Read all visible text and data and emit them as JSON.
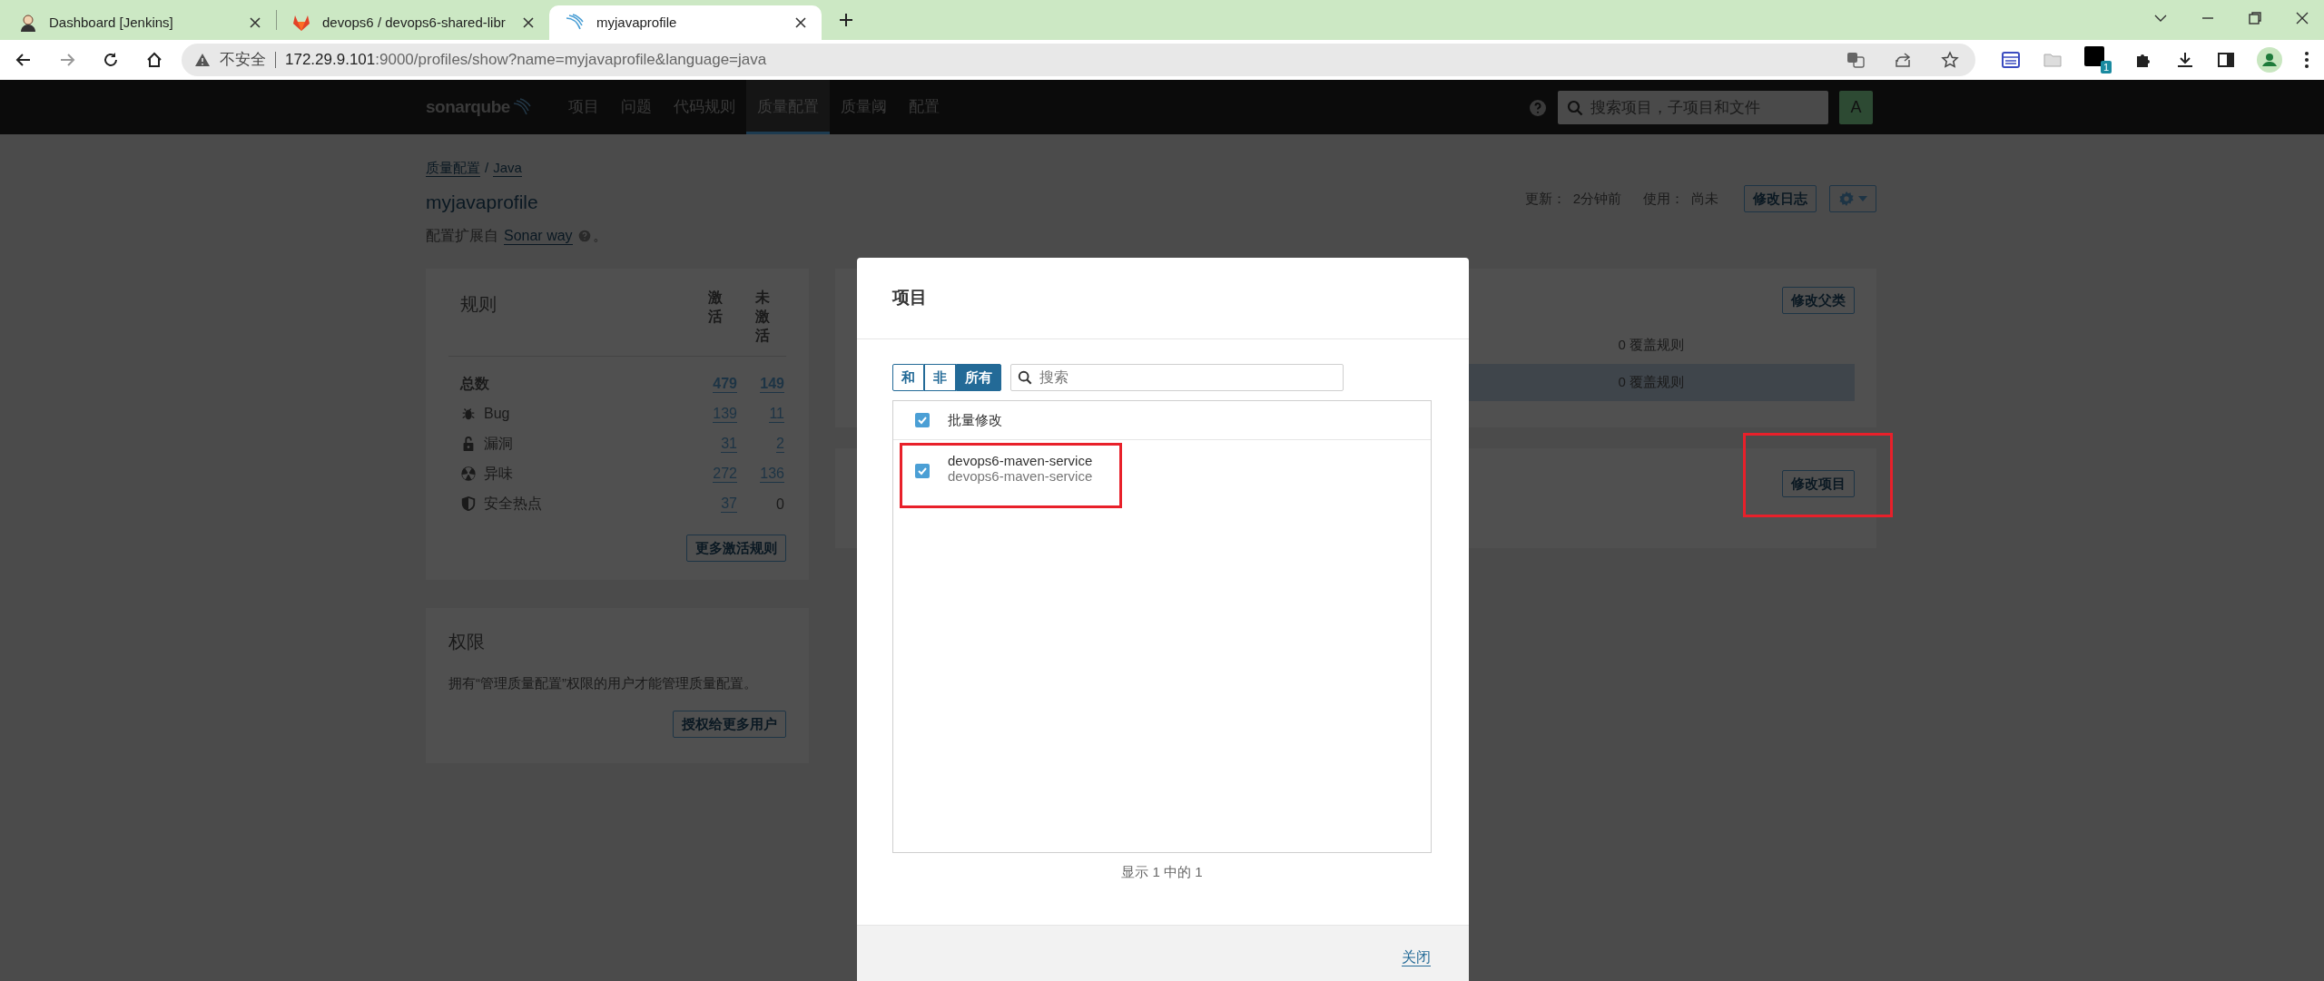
{
  "browser": {
    "tabs": [
      {
        "title": "Dashboard [Jenkins]",
        "selected": false
      },
      {
        "title": "devops6 / devops6-shared-libr",
        "selected": false
      },
      {
        "title": "myjavaprofile",
        "selected": true
      }
    ],
    "address": {
      "security_label": "不安全",
      "host": "172.29.9.101",
      "rest": ":9000/profiles/show?name=myjavaprofile&language=java"
    },
    "extension_badge": "1"
  },
  "nav": {
    "logo": "sonarqube",
    "items": [
      {
        "label": "项目",
        "selected": false
      },
      {
        "label": "问题",
        "selected": false
      },
      {
        "label": "代码规则",
        "selected": false
      },
      {
        "label": "质量配置",
        "selected": true
      },
      {
        "label": "质量阈",
        "selected": false
      },
      {
        "label": "配置",
        "selected": false
      }
    ],
    "search_placeholder": "搜索项目，子项目和文件",
    "avatar": "A"
  },
  "page": {
    "breadcrumb": [
      "质量配置",
      "Java"
    ],
    "breadcrumb_separator": "/",
    "title": "myjavaprofile",
    "extends": {
      "prefix": "配置扩展自",
      "link": "Sonar way",
      "suffix": "。"
    },
    "meta": [
      {
        "label": "更新：",
        "value": "2分钟前"
      },
      {
        "label": "使用：",
        "value": "尚未"
      }
    ],
    "changelog_button": "修改日志"
  },
  "rules_card": {
    "title": "规则",
    "columns": [
      "激活",
      "未激活"
    ],
    "rows": [
      {
        "kind": "total",
        "label": "总数",
        "active": "479",
        "inactive": "149",
        "inactive_link": true
      },
      {
        "kind": "bug",
        "label": "Bug",
        "active": "139",
        "inactive": "11",
        "inactive_link": true
      },
      {
        "kind": "vulnerability",
        "label": "漏洞",
        "active": "31",
        "inactive": "2",
        "inactive_link": true
      },
      {
        "kind": "smell",
        "label": "异味",
        "active": "272",
        "inactive": "136",
        "inactive_link": true
      },
      {
        "kind": "hotspot",
        "label": "安全热点",
        "active": "37",
        "inactive": "0",
        "inactive_link": false
      }
    ],
    "button": "更多激活规则"
  },
  "permissions_card": {
    "title": "权限",
    "text": "拥有“管理质量配置”权限的用户才能管理质量配置。",
    "button": "授权给更多用户"
  },
  "inheritance_card": {
    "button": "修改父类",
    "rows": [
      {
        "text": "0 覆盖规则",
        "highlighted": false
      },
      {
        "text": "0 覆盖规则",
        "highlighted": true
      }
    ]
  },
  "projects_card": {
    "button": "修改项目"
  },
  "modal": {
    "title": "项目",
    "filters": [
      {
        "label": "和",
        "selected": false
      },
      {
        "label": "非",
        "selected": false
      },
      {
        "label": "所有",
        "selected": true
      }
    ],
    "search_placeholder": "搜索",
    "bulk": {
      "label": "批量修改",
      "checked": true
    },
    "items": [
      {
        "name": "devops6-maven-service",
        "key": "devops6-maven-service",
        "checked": true
      }
    ],
    "count": "显示 1 中的 1",
    "close": "关闭"
  }
}
